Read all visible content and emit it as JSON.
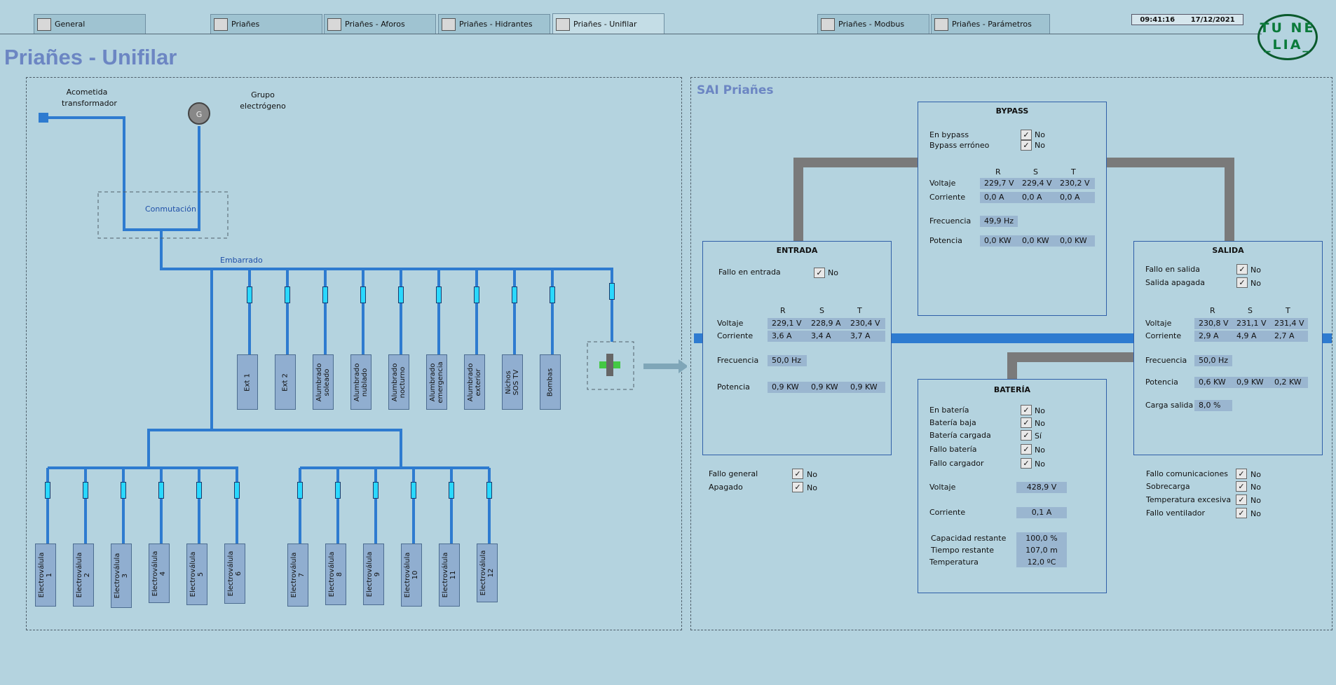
{
  "tabs": [
    {
      "label": "General"
    },
    {
      "label": "Priañes"
    },
    {
      "label": "Priañes - Aforos"
    },
    {
      "label": "Priañes - Hidrantes"
    },
    {
      "label": "Priañes - Unifilar"
    },
    {
      "label": "Priañes - Modbus"
    },
    {
      "label": "Priañes - Parámetros"
    }
  ],
  "clock": {
    "time": "09:41:16",
    "date": "17/12/2021"
  },
  "logo": {
    "line1": "TU NE",
    "line2": "_LIA_"
  },
  "page_title": "Priañes - Unifilar",
  "unifilar": {
    "acometida": "Acometida transformador",
    "grupo": "Grupo electrógeno",
    "conmutacion": "Conmutación",
    "embarrado": "Embarrado",
    "feeders": [
      "Ext 1",
      "Ext 2",
      "Alumbrado soleado",
      "Alumbrado nublado",
      "Alumbrado nocturno",
      "Alumbrado emergencia",
      "Alumbrado exterior",
      "Nichos SOS TV",
      "Bombas"
    ],
    "valves": [
      "Electroválula 1",
      "Electroválula 2",
      "Electroválula 3",
      "Electroválula 4",
      "Electroválula 5",
      "Electroválula 6",
      "Electroválula 7",
      "Electroválula 8",
      "Electroválula 9",
      "Electroválula 10",
      "Electroválula 11",
      "Electroválula 12"
    ]
  },
  "sai": {
    "title": "SAI Priañes",
    "phase_labels": [
      "R",
      "S",
      "T"
    ],
    "bypass": {
      "title": "BYPASS",
      "en_bypass": "En bypass",
      "en_bypass_val": "No",
      "erroneo": "Bypass erróneo",
      "erroneo_val": "No",
      "voltaje": "Voltaje",
      "v": [
        "229,7 V",
        "229,4 V",
        "230,2 V"
      ],
      "corriente": "Corriente",
      "i": [
        "0,0 A",
        "0,0 A",
        "0,0 A"
      ],
      "frecuencia": "Frecuencia",
      "f": "49,9 Hz",
      "potencia": "Potencia",
      "p": [
        "0,0 KW",
        "0,0 KW",
        "0,0 KW"
      ]
    },
    "entrada": {
      "title": "ENTRADA",
      "fallo": "Fallo en entrada",
      "fallo_val": "No",
      "voltaje": "Voltaje",
      "v": [
        "229,1 V",
        "228,9 A",
        "230,4 V"
      ],
      "corriente": "Corriente",
      "i": [
        "3,6 A",
        "3,4 A",
        "3,7 A"
      ],
      "frecuencia": "Frecuencia",
      "f": "50,0 Hz",
      "potencia": "Potencia",
      "p": [
        "0,9 KW",
        "0,9 KW",
        "0,9 KW"
      ]
    },
    "salida": {
      "title": "SALIDA",
      "fallo": "Fallo en salida",
      "fallo_val": "No",
      "apagada": "Salida apagada",
      "apagada_val": "No",
      "voltaje": "Voltaje",
      "v": [
        "230,8 V",
        "231,1 V",
        "231,4 V"
      ],
      "corriente": "Corriente",
      "i": [
        "2,9 A",
        "4,9 A",
        "2,7 A"
      ],
      "frecuencia": "Frecuencia",
      "f": "50,0 Hz",
      "potencia": "Potencia",
      "p": [
        "0,6 KW",
        "0,9 KW",
        "0,2 KW"
      ],
      "carga": "Carga salida",
      "carga_val": "8,0 %"
    },
    "bateria": {
      "title": "BATERÍA",
      "rows": [
        {
          "label": "En batería",
          "val": "No"
        },
        {
          "label": "Batería  baja",
          "val": "No"
        },
        {
          "label": "Batería cargada",
          "val": "Sí"
        },
        {
          "label": "Fallo batería",
          "val": "No"
        },
        {
          "label": "Fallo cargador",
          "val": "No"
        }
      ],
      "voltaje": "Voltaje",
      "v": "428,9 V",
      "corriente": "Corriente",
      "i": "0,1 A",
      "capacidad": "Capacidad restante",
      "capacidad_val": "100,0 %",
      "tiempo": "Tiempo restante",
      "tiempo_val": "107,0 m",
      "temperatura": "Temperatura",
      "temperatura_val": "12,0 ºC"
    },
    "general": [
      {
        "label": "Fallo general",
        "val": "No"
      },
      {
        "label": "Apagado",
        "val": "No"
      }
    ],
    "alarms": [
      {
        "label": "Fallo comunicaciones",
        "val": "No"
      },
      {
        "label": "Sobrecarga",
        "val": "No"
      },
      {
        "label": "Temperatura excesiva",
        "val": "No"
      },
      {
        "label": "Fallo ventilador",
        "val": "No"
      }
    ]
  },
  "colors": {
    "background": "#b4d3df",
    "bus": "#2e7bd0",
    "title": "#6c86c3",
    "gray_bus": "#7a7a7a"
  }
}
